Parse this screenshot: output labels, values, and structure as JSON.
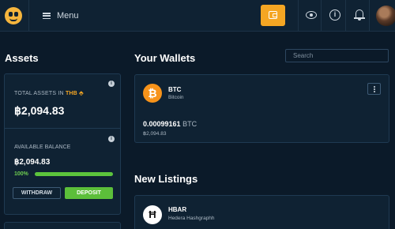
{
  "header": {
    "menu_label": "Menu",
    "icons": [
      "logo-icon",
      "hamburger-icon",
      "wallet-icon",
      "eye-icon",
      "info-icon",
      "bell-icon",
      "avatar"
    ]
  },
  "assets": {
    "title": "Assets",
    "total_label": "TOTAL ASSETS IN",
    "currency": "THB",
    "currency_caret": "⬘",
    "total_value": "฿2,094.83",
    "available_label": "AVAILABLE BALANCE",
    "available_value": "฿2,094.83",
    "available_percent_label": "100%",
    "available_fraction": 1.0,
    "withdraw_label": "WITHDRAW",
    "deposit_label": "DEPOSIT"
  },
  "wallets": {
    "title": "Your Wallets",
    "search_placeholder": "Search",
    "items": [
      {
        "symbol": "BTC",
        "name": "Bitcoin",
        "icon_glyph": "₿",
        "amount": "0.00099161",
        "unit": "BTC",
        "fiat": "฿2,094.83"
      }
    ]
  },
  "listings": {
    "title": "New Listings",
    "items": [
      {
        "symbol": "HBAR",
        "name": "Hedera Hashgraphh",
        "icon_glyph": "Ħ"
      }
    ]
  },
  "colors": {
    "background": "#0b1a29",
    "card": "#0f2233",
    "accent": "#f5a623",
    "deposit": "#5cbf3a",
    "btc": "#f7931a"
  }
}
